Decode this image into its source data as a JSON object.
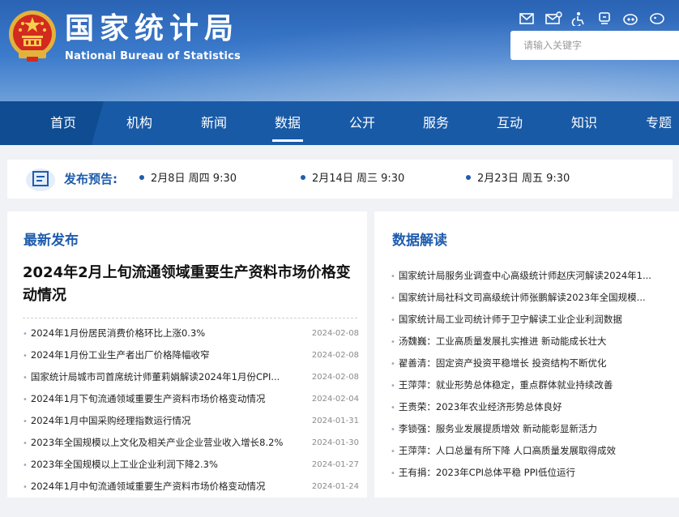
{
  "header": {
    "brand_cn": "国家统计局",
    "brand_en": "National Bureau of Statistics",
    "search_placeholder": "请输入关键字",
    "tool_icons": [
      "mail-icon",
      "mailbox-icon",
      "accessibility-icon",
      "elder-mode-icon",
      "weibo-icon",
      "wechat-icon"
    ]
  },
  "nav": {
    "items": [
      "首页",
      "机构",
      "新闻",
      "数据",
      "公开",
      "服务",
      "互动",
      "知识",
      "专题"
    ],
    "active": "数据"
  },
  "preview": {
    "label": "发布预告:",
    "items": [
      "2月8日 周四 9:30",
      "2月14日 周三 9:30",
      "2月23日 周五 9:30"
    ]
  },
  "latest": {
    "title": "最新发布",
    "headline": "2024年2月上旬流通领域重要生产资料市场价格变动情况",
    "rows": [
      {
        "title": "2024年1月份居民消费价格环比上涨0.3%",
        "date": "2024-02-08"
      },
      {
        "title": "2024年1月份工业生产者出厂价格降幅收窄",
        "date": "2024-02-08"
      },
      {
        "title": "国家统计局城市司首席统计师董莉娟解读2024年1月份CPI...",
        "date": "2024-02-08"
      },
      {
        "title": "2024年1月下旬流通领域重要生产资料市场价格变动情况",
        "date": "2024-02-04"
      },
      {
        "title": "2024年1月中国采购经理指数运行情况",
        "date": "2024-01-31"
      },
      {
        "title": "2023年全国规模以上文化及相关产业企业营业收入增长8.2%",
        "date": "2024-01-30"
      },
      {
        "title": "2023年全国规模以上工业企业利润下降2.3%",
        "date": "2024-01-27"
      },
      {
        "title": "2024年1月中旬流通领域重要生产资料市场价格变动情况",
        "date": "2024-01-24"
      }
    ]
  },
  "interpretation": {
    "title": "数据解读",
    "rows": [
      "国家统计局服务业调查中心高级统计师赵庆河解读2024年1...",
      "国家统计局社科文司高级统计师张鹏解读2023年全国规模...",
      "国家统计局工业司统计师于卫宁解读工业企业利润数据",
      "汤魏巍：工业高质量发展扎实推进 新动能成长壮大",
      "翟善清：固定资产投资平稳增长 投资结构不断优化",
      "王萍萍：就业形势总体稳定，重点群体就业持续改善",
      "王贵荣：2023年农业经济形势总体良好",
      "李锁强：服务业发展提质增效 新动能彰显新活力",
      "王萍萍：人口总量有所下降 人口高质量发展取得成效",
      "王有捐：2023年CPI总体平稳 PPI低位运行"
    ]
  },
  "colors": {
    "brand_blue": "#1f5cad",
    "nav_blue": "#195aa6",
    "banner_blue": "#3c7bcc"
  }
}
